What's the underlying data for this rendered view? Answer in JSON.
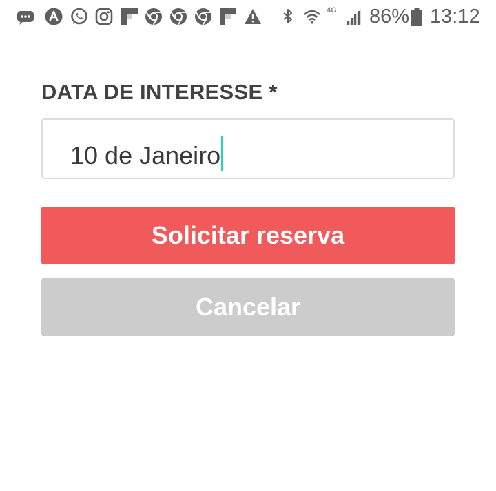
{
  "status_bar": {
    "network_type": "4G",
    "battery_percent": "86%",
    "time": "13:12",
    "icons": [
      "messages-icon",
      "app-a-icon",
      "whatsapp-icon",
      "instagram-icon",
      "flipboard-icon",
      "chrome-icon",
      "chrome-icon",
      "chrome-icon",
      "flipboard-icon",
      "warning-icon",
      "bluetooth-icon",
      "wifi-icon",
      "signal-icon",
      "battery-icon"
    ]
  },
  "form": {
    "label": "DATA DE INTERESSE *",
    "date_value": "10 de Janeiro"
  },
  "buttons": {
    "primary_label": "Solicitar reserva",
    "secondary_label": "Cancelar"
  },
  "colors": {
    "primary": "#f05a5b",
    "secondary": "#cccccc",
    "caret": "#1fd6c2",
    "label_text": "#424242",
    "status_icons": "#5f5f5f"
  }
}
